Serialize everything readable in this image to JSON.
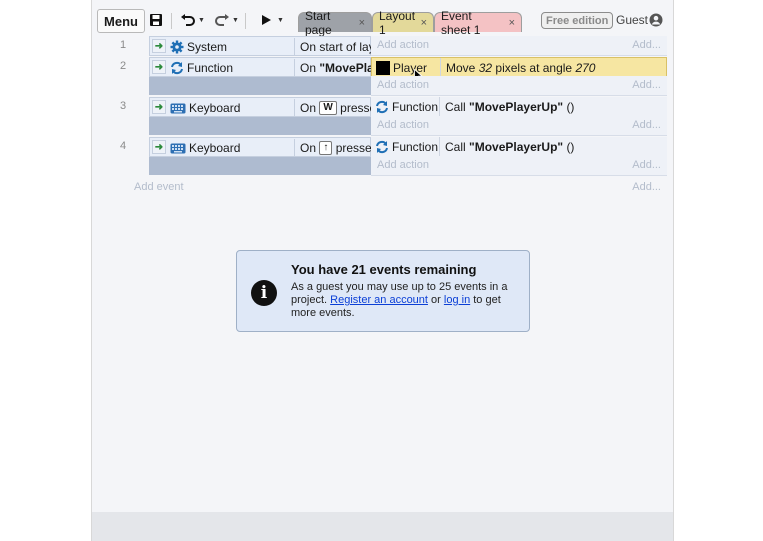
{
  "toolbar": {
    "menu_label": "Menu",
    "tabs": [
      {
        "label": "Start page",
        "close": "×"
      },
      {
        "label": "Layout 1",
        "close": "×"
      },
      {
        "label": "Event sheet 1",
        "close": "×"
      }
    ],
    "edition_badge": "Free edition",
    "user_label": "Guest"
  },
  "events": [
    {
      "number": "1",
      "conditions": [
        {
          "object": "System",
          "text": "On start of layout"
        }
      ],
      "actions": [],
      "add_action": "Add action",
      "add_more": "Add..."
    },
    {
      "number": "2",
      "conditions": [
        {
          "object": "Function",
          "text_pre": "On ",
          "text_bold": "\"MovePlayerUp\""
        }
      ],
      "actions": [
        {
          "object": "Player",
          "text_pre": "Move ",
          "text_em": "32",
          "text_mid": " pixels at angle ",
          "text_em2": "270"
        }
      ],
      "add_action": "Add action",
      "add_more": "Add..."
    },
    {
      "number": "3",
      "conditions": [
        {
          "object": "Keyboard",
          "text_pre": "On ",
          "key": "W",
          "text_post": " pressed"
        }
      ],
      "actions": [
        {
          "object": "Function",
          "text_pre": "Call ",
          "text_bold": "\"MovePlayerUp\"",
          "text_post": " ()"
        }
      ],
      "add_action": "Add action",
      "add_more": "Add..."
    },
    {
      "number": "4",
      "conditions": [
        {
          "object": "Keyboard",
          "text_pre": "On ",
          "key": "↑",
          "text_post": " pressed"
        }
      ],
      "actions": [
        {
          "object": "Function",
          "text_pre": "Call ",
          "text_bold": "\"MovePlayerUp\"",
          "text_post": " ()"
        }
      ],
      "add_action": "Add action",
      "add_more": "Add..."
    }
  ],
  "add_event": "Add event",
  "add_event_more": "Add...",
  "notice": {
    "title": "You have 21 events remaining",
    "line1": "As a guest you may use up to 25 events in a",
    "line2_pre": "project. ",
    "link_register": "Register an account",
    "line2_mid": " or ",
    "link_login": "log in",
    "line2_post": " to get",
    "line3": "more events."
  },
  "colors": {
    "highlight": "#f6e6a2",
    "condition_bg": "#e8eef8",
    "notice_bg": "#dfe8f7",
    "start_tab": "#9ea2a8",
    "layout_tab": "#e3d99a",
    "event_tab": "#f4c2c4"
  },
  "icons": [
    "save-icon",
    "undo-icon",
    "redo-icon",
    "play-icon",
    "gear-icon",
    "function-icon",
    "keyboard-icon",
    "user-icon",
    "info-icon",
    "cursor-icon"
  ]
}
